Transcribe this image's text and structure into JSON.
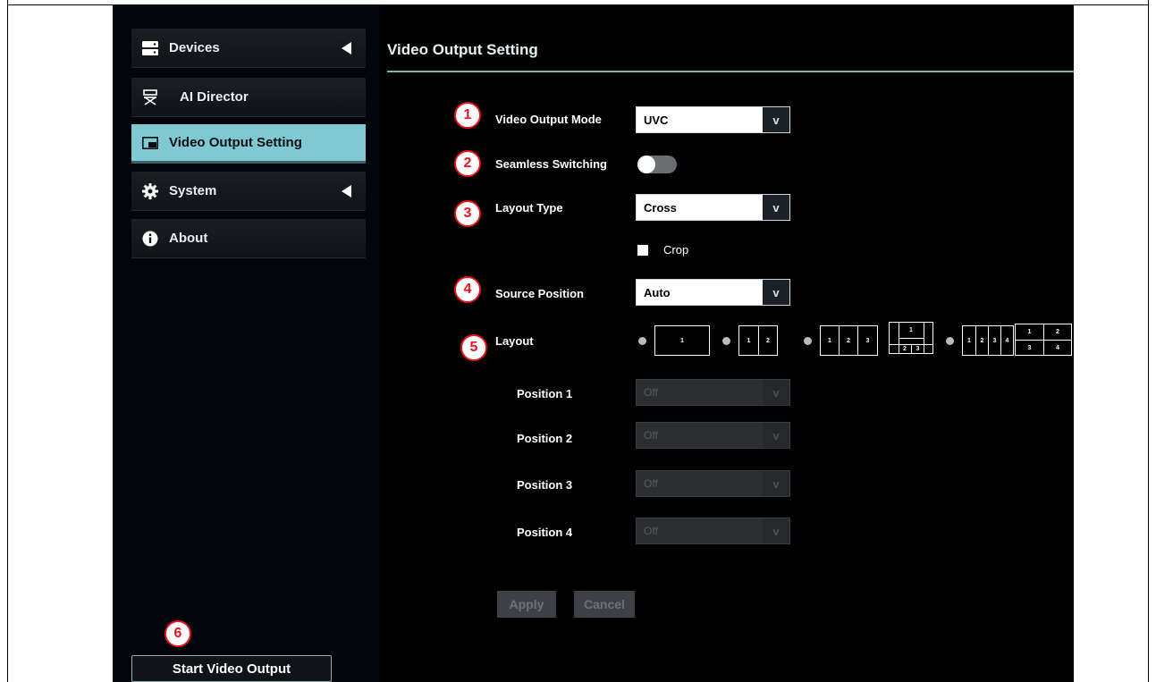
{
  "sidebar": {
    "items": [
      {
        "label": "Devices",
        "icon": "server-icon",
        "has_arrow": true
      },
      {
        "label": "AI Director",
        "icon": "director-chair-icon",
        "has_arrow": false
      },
      {
        "label": "Video Output Setting",
        "icon": "picture-in-picture-icon",
        "has_arrow": false,
        "active": true
      },
      {
        "label": "System",
        "icon": "gear-icon",
        "has_arrow": true
      },
      {
        "label": "About",
        "icon": "info-icon",
        "has_arrow": false
      }
    ],
    "start_button": "Start Video Output"
  },
  "main": {
    "title": "Video Output Setting",
    "video_output_mode": {
      "label": "Video Output Mode",
      "value": "UVC"
    },
    "seamless_switching": {
      "label": "Seamless Switching",
      "enabled": false
    },
    "layout_type": {
      "label": "Layout Type",
      "value": "Cross"
    },
    "crop": {
      "label": "Crop",
      "checked": false
    },
    "source_position": {
      "label": "Source Position",
      "value": "Auto"
    },
    "layout": {
      "label": "Layout",
      "options": [
        {
          "cells": [
            "1"
          ]
        },
        {
          "cells": [
            "1",
            "2"
          ]
        },
        {
          "cells": [
            "1",
            "2",
            "3"
          ]
        },
        {
          "cells": [
            "1",
            "2",
            "3"
          ]
        },
        {
          "cells": [
            "1",
            "2",
            "3",
            "4"
          ]
        },
        {
          "cells": [
            "1",
            "2",
            "3",
            "4"
          ]
        }
      ]
    },
    "positions": [
      {
        "label": "Position 1",
        "value": "Off"
      },
      {
        "label": "Position 2",
        "value": "Off"
      },
      {
        "label": "Position 3",
        "value": "Off"
      },
      {
        "label": "Position 4",
        "value": "Off"
      }
    ],
    "apply_label": "Apply",
    "cancel_label": "Cancel",
    "select_arrow": "v"
  },
  "markers": [
    "1",
    "2",
    "3",
    "4",
    "5",
    "6"
  ],
  "colors": {
    "accent": "#7fc9d2",
    "marker": "#e8141a",
    "sidebar_bg": "#02050c",
    "main_bg": "#000000"
  }
}
